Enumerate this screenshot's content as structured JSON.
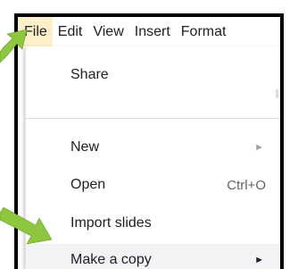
{
  "menubar": {
    "items": [
      {
        "label": "File"
      },
      {
        "label": "Edit"
      },
      {
        "label": "View"
      },
      {
        "label": "Insert"
      },
      {
        "label": "Format"
      }
    ]
  },
  "file_menu": {
    "share_label": "Share",
    "new_label": "New",
    "open_label": "Open",
    "open_shortcut": "Ctrl+O",
    "import_slides_label": "Import slides",
    "make_copy_label": "Make a copy",
    "submenu_arrow": "►"
  },
  "colors": {
    "active_menu_bg": "#fdefc7",
    "pointer_arrow": "#8dc63f",
    "hover_item_bg": "#f1f3f4"
  }
}
